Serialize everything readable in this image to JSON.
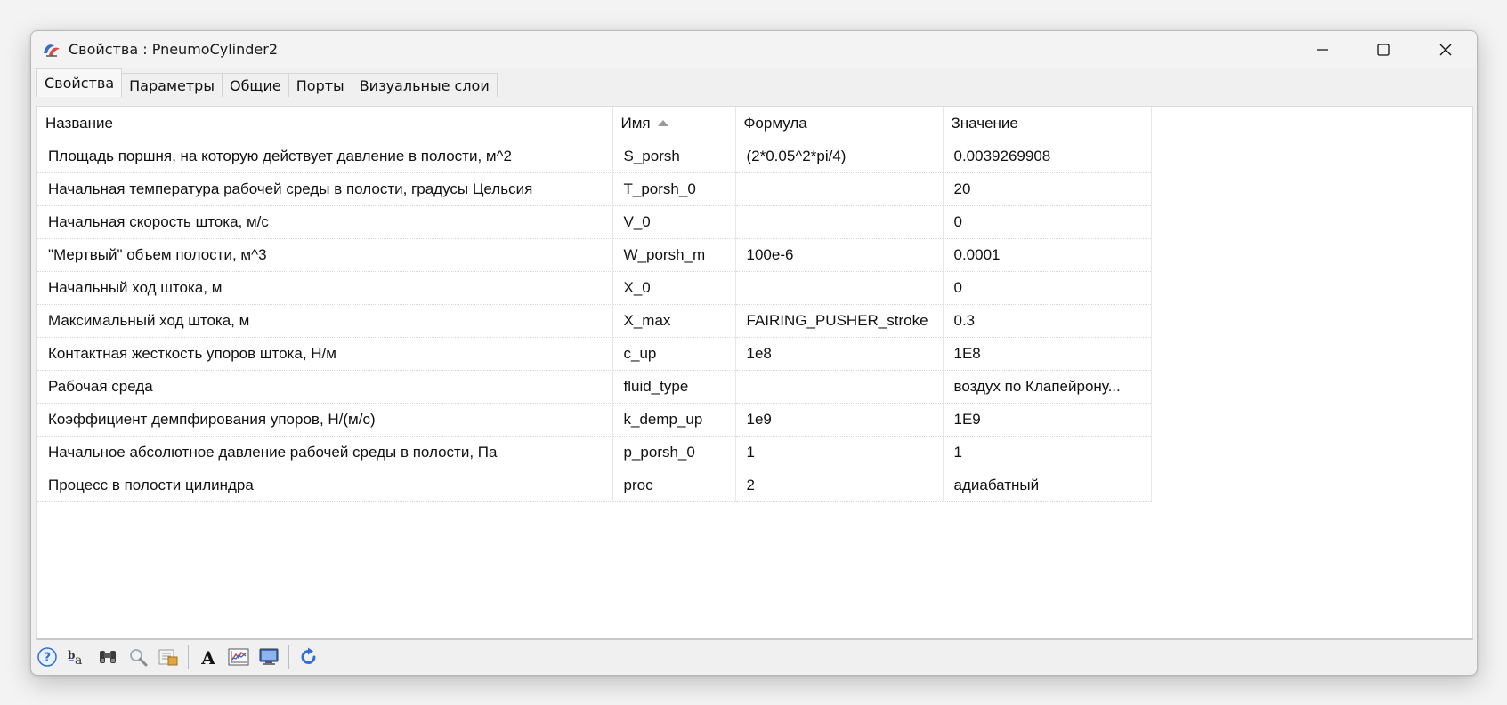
{
  "window": {
    "title": "Свойства : PneumoCylinder2"
  },
  "tabs": [
    {
      "label": "Свойства",
      "active": true
    },
    {
      "label": "Параметры",
      "active": false
    },
    {
      "label": "Общие",
      "active": false
    },
    {
      "label": "Порты",
      "active": false
    },
    {
      "label": "Визуальные слои",
      "active": false
    }
  ],
  "table": {
    "headers": {
      "name": "Название",
      "id": "Имя",
      "formula": "Формула",
      "value": "Значение"
    },
    "sorted_by": "Имя",
    "rows": [
      {
        "name": "Площадь поршня, на которую действует давление в полости, м^2",
        "id": "S_porsh",
        "formula": "(2*0.05^2*pi/4)",
        "value": "0.0039269908"
      },
      {
        "name": "Начальная температура рабочей среды в полости, градусы Цельсия",
        "id": "T_porsh_0",
        "formula": "",
        "value": "20"
      },
      {
        "name": "Начальная скорость штока, м/с",
        "id": "V_0",
        "formula": "",
        "value": "0"
      },
      {
        "name": "\"Мертвый\" объем полости, м^3",
        "id": "W_porsh_m",
        "formula": "100e-6",
        "value": "0.0001"
      },
      {
        "name": "Начальный ход штока, м",
        "id": "X_0",
        "formula": "",
        "value": "0"
      },
      {
        "name": "Максимальный ход штока, м",
        "id": "X_max",
        "formula": "FAIRING_PUSHER_stroke",
        "value": "0.3"
      },
      {
        "name": "Контактная жесткость упоров штока, Н/м",
        "id": "c_up",
        "formula": "1e8",
        "value": "1E8"
      },
      {
        "name": "Рабочая среда",
        "id": "fluid_type",
        "formula": "",
        "value": "воздух по Клапейрону..."
      },
      {
        "name": "Коэффициент демпфирования упоров, Н/(м/с)",
        "id": "k_demp_up",
        "formula": "1e9",
        "value": "1E9"
      },
      {
        "name": "Начальное абсолютное давление рабочей среды в полости, Па",
        "id": "p_porsh_0",
        "formula": "1",
        "value": "1"
      },
      {
        "name": "Процесс в полости цилиндра",
        "id": "proc",
        "formula": "2",
        "value": "адиабатный"
      }
    ]
  },
  "toolbar": {
    "icons": [
      "help-icon",
      "rename-icon",
      "binoculars-icon",
      "magnifier-icon",
      "properties-icon",
      "font-icon",
      "chart-icon",
      "monitor-icon",
      "refresh-icon"
    ]
  },
  "colors": {
    "window_bg": "#f0f0f0",
    "grid_bg": "#ffffff",
    "accent_blue": "#2f6fd6"
  }
}
